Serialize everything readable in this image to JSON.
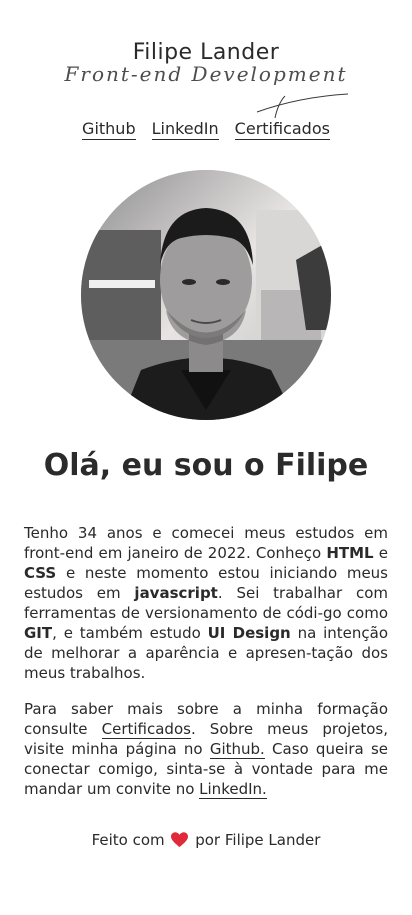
{
  "header": {
    "name": "Filipe Lander",
    "tagline": "Front-end Development"
  },
  "nav": {
    "items": [
      {
        "label": "Github"
      },
      {
        "label": "LinkedIn"
      },
      {
        "label": "Certificados"
      }
    ]
  },
  "main": {
    "title": "Olá, eu sou o Filipe",
    "bio1": {
      "t1": "Tenho 34 anos e comecei meus estudos em front-end em janeiro de 2022. Conheço ",
      "b1": "HTML",
      "t2": " e ",
      "b2": "CSS",
      "t3": " e neste momento estou iniciando meus estudos em ",
      "b3": "javascript",
      "t4": ". Sei trabalhar com ferramentas de versionamento de códi-go como ",
      "b4": "GIT",
      "t5": ", e também estudo ",
      "b5": "UI Design",
      "t6": " na intenção de melhorar a aparência e apresen-tação dos meus trabalhos."
    },
    "bio2": {
      "t1": "Para saber mais sobre a minha formação consulte ",
      "link1": "Certificados",
      "t2": ". Sobre meus projetos, visite minha página no ",
      "link2": "Github.",
      "t3": " Caso queira se conectar comigo, sinta-se à vontade para me mandar um convite no ",
      "link3": "LinkedIn."
    }
  },
  "footer": {
    "prefix": "Feito com",
    "heart_icon": "heart-icon",
    "suffix": "por Filipe Lander",
    "heart_color": "#e0293a"
  },
  "colors": {
    "text": "#2a2a2a",
    "background": "#ffffff"
  }
}
